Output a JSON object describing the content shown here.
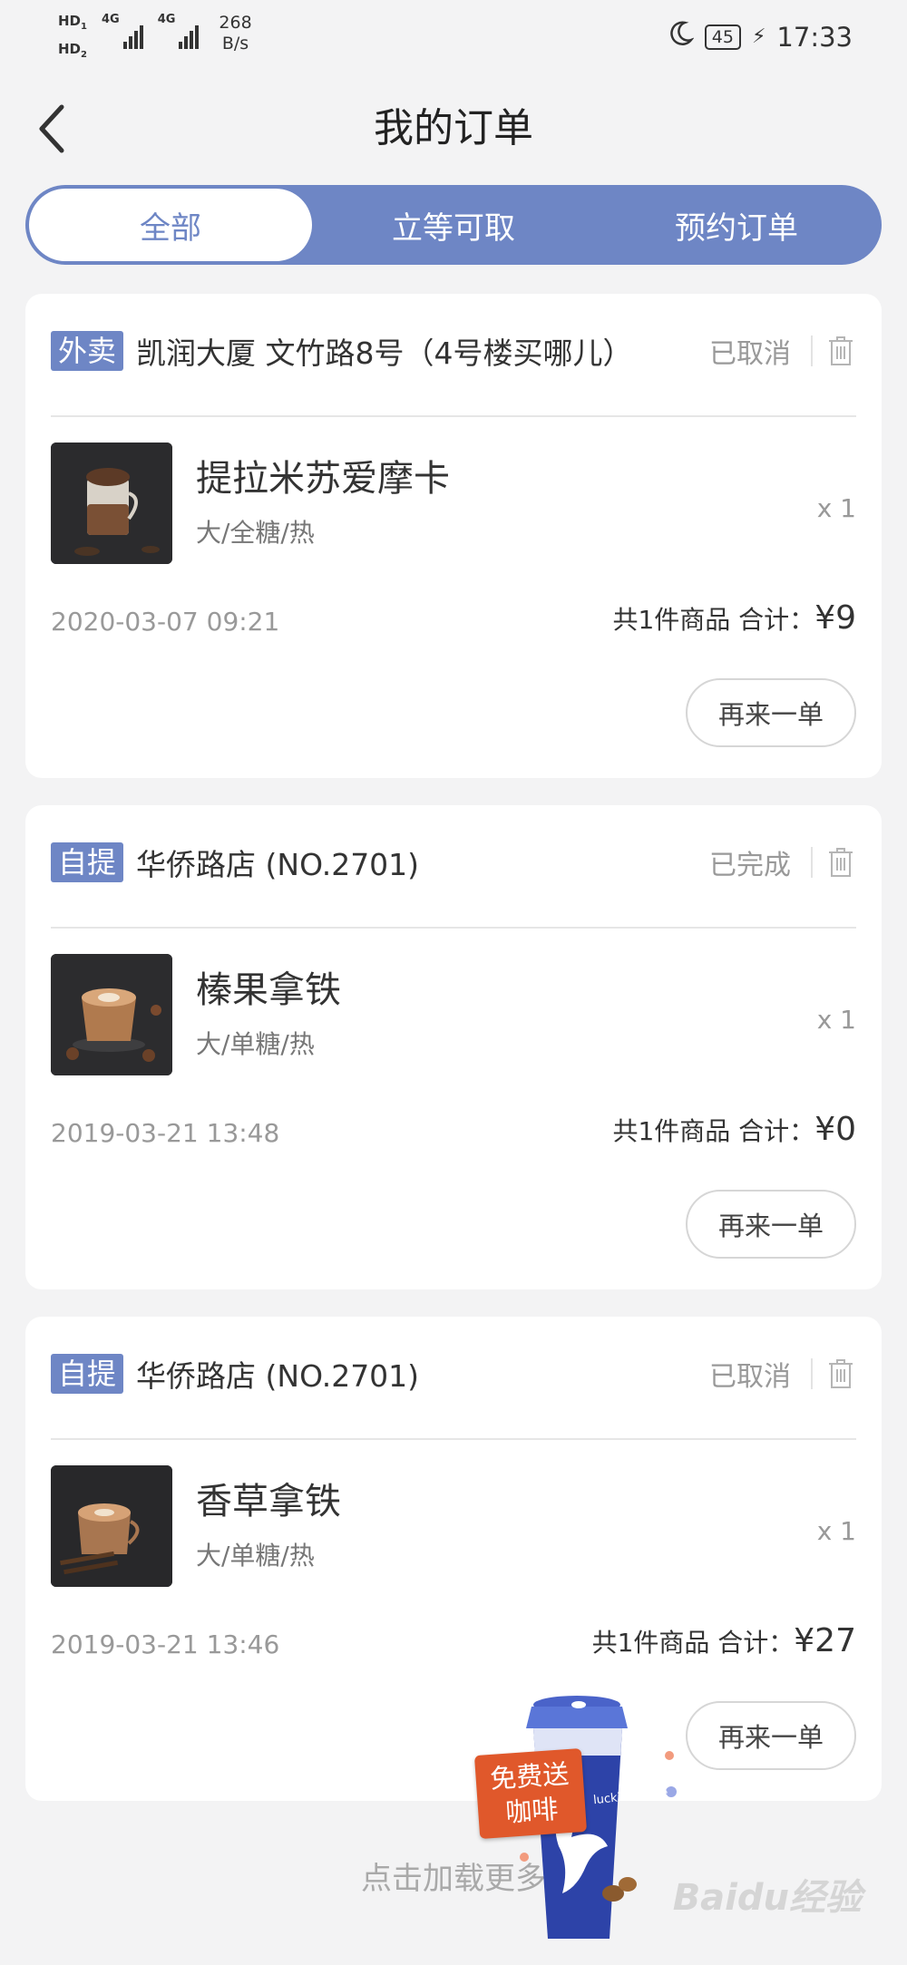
{
  "status_bar": {
    "hd1": "HD",
    "hd1_sub": "1",
    "hd2": "HD",
    "hd2_sub": "2",
    "net1": "4G",
    "net2": "4G",
    "speed_value": "268",
    "speed_unit": "B/s",
    "battery": "45",
    "time": "17:33"
  },
  "header": {
    "title": "我的订单"
  },
  "tabs": [
    {
      "label": "全部",
      "active": true
    },
    {
      "label": "立等可取",
      "active": false
    },
    {
      "label": "预约订单",
      "active": false
    }
  ],
  "orders": [
    {
      "type": "外卖",
      "store": "凯润大厦 文竹路8号（4号楼买哪儿）",
      "status": "已取消",
      "product": "提拉米苏爱摩卡",
      "spec": "大/全糖/热",
      "qty": "x 1",
      "date": "2020-03-07 09:21",
      "summary": "共1件商品 合计：",
      "price": "¥9",
      "reorder": "再来一单"
    },
    {
      "type": "自提",
      "store": "华侨路店 (NO.2701)",
      "status": "已完成",
      "product": "榛果拿铁",
      "spec": "大/单糖/热",
      "qty": "x 1",
      "date": "2019-03-21 13:48",
      "summary": "共1件商品 合计：",
      "price": "¥0",
      "reorder": "再来一单"
    },
    {
      "type": "自提",
      "store": "华侨路店 (NO.2701)",
      "status": "已取消",
      "product": "香草拿铁",
      "spec": "大/单糖/热",
      "qty": "x 1",
      "date": "2019-03-21 13:46",
      "summary": "共1件商品 合计：",
      "price": "¥27",
      "reorder": "再来一单"
    }
  ],
  "footer": {
    "load_more": "点击加载更多"
  },
  "promo": {
    "label_line1": "免费送",
    "label_line2": "咖啡",
    "cup_text": "luckin coffee"
  },
  "watermark": "Baidu经验",
  "colors": {
    "accent": "#6e86c5",
    "background": "#f3f3f4",
    "promo_orange": "#e0582b",
    "cup_blue": "#2d43a8"
  }
}
